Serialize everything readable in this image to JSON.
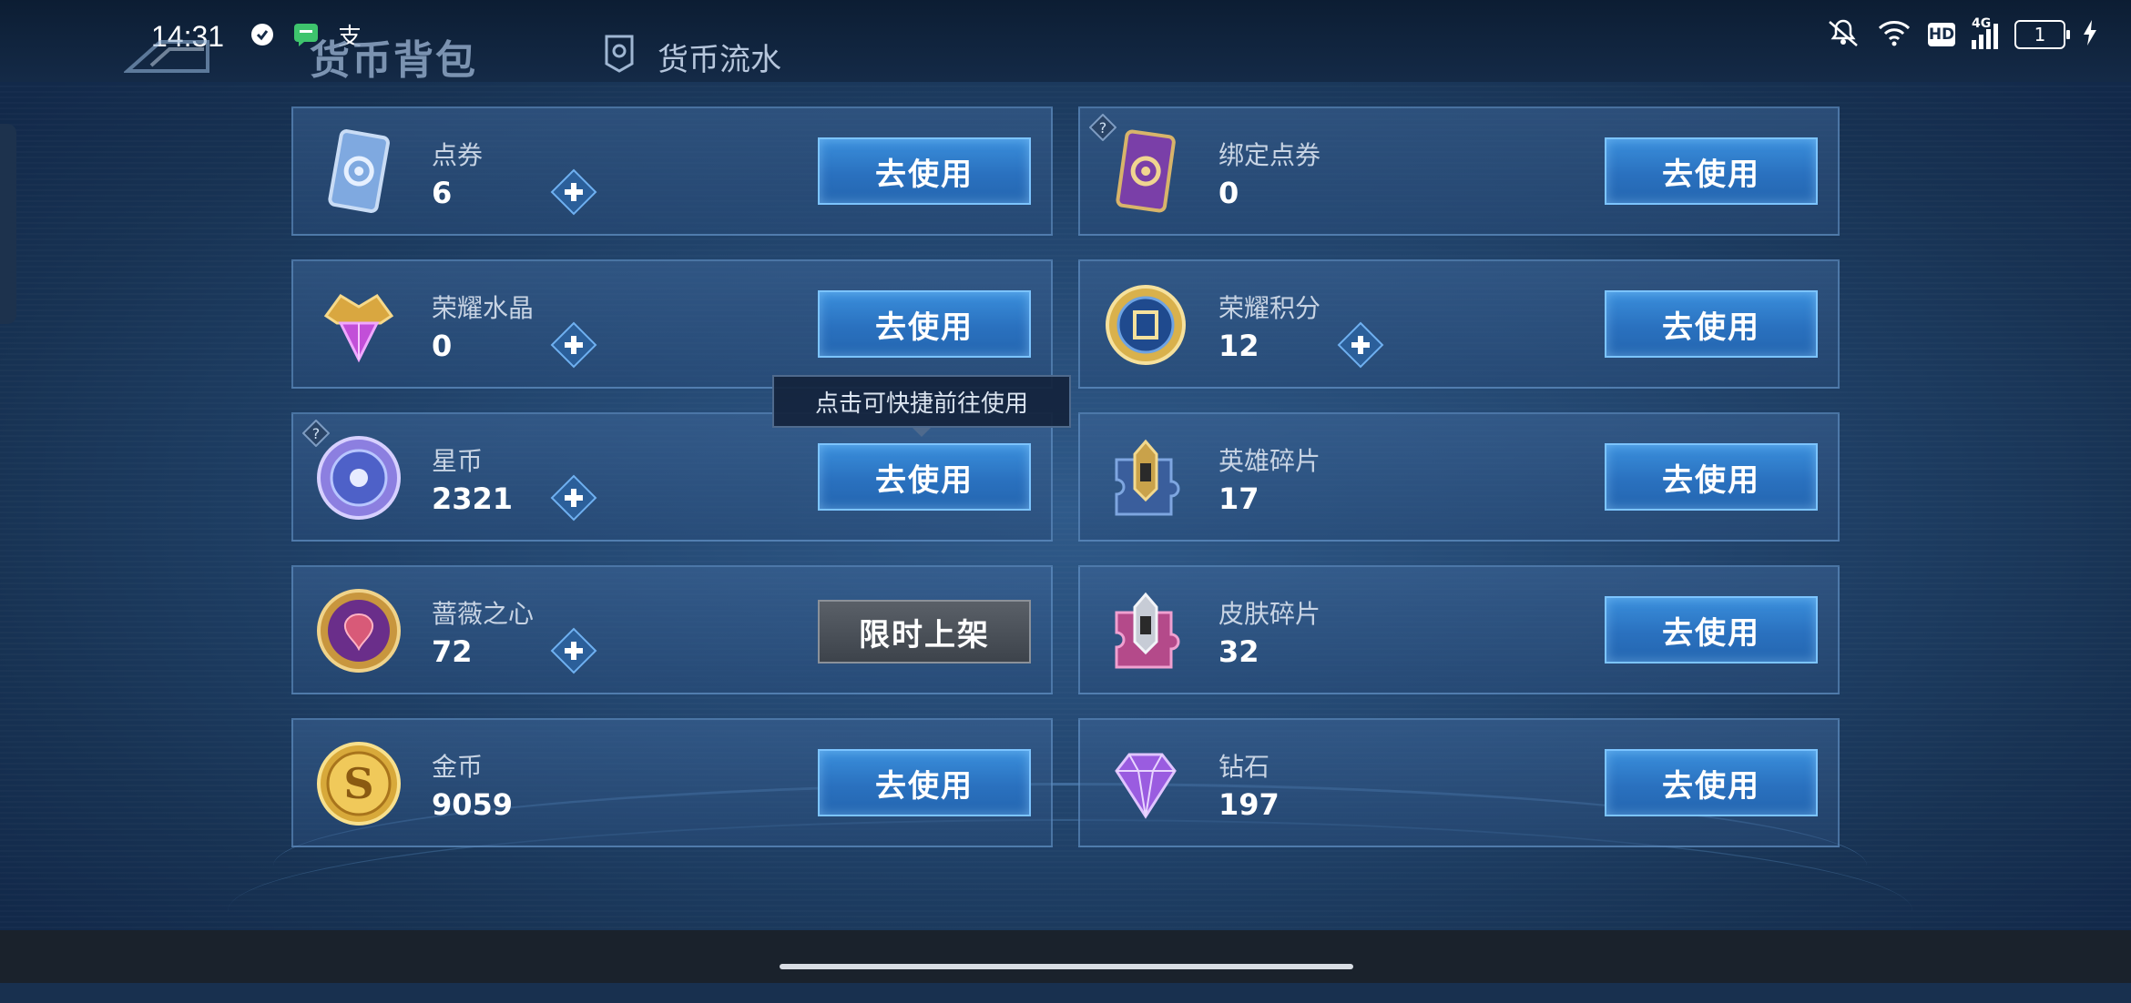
{
  "status_bar": {
    "time": "14:31",
    "left_icons": [
      "shield-icon",
      "message-icon",
      "alipay-icon"
    ],
    "alipay_glyph": "支",
    "right_icons": [
      "mute-icon",
      "wifi-icon",
      "hd-icon",
      "4g-signal-icon",
      "battery-icon",
      "charging-icon"
    ],
    "hd_label": "HD",
    "network_label": "4G",
    "battery_level": "1"
  },
  "header": {
    "title": "货币背包",
    "flow_tab_label": "货币流水"
  },
  "tooltip": {
    "text": "点击可快捷前往使用"
  },
  "currencies": [
    {
      "name": "点券",
      "amount": "6",
      "icon": "coupon-card-icon",
      "has_plus": true,
      "has_help": false,
      "button": "去使用"
    },
    {
      "name": "绑定点券",
      "amount": "0",
      "icon": "bound-coupon-card-icon",
      "has_plus": false,
      "has_help": true,
      "button": "去使用"
    },
    {
      "name": "荣耀水晶",
      "amount": "0",
      "icon": "glory-crystal-icon",
      "has_plus": true,
      "has_help": false,
      "button": "去使用"
    },
    {
      "name": "荣耀积分",
      "amount": "12",
      "icon": "glory-points-icon",
      "has_plus": true,
      "has_help": false,
      "button": "去使用"
    },
    {
      "name": "星币",
      "amount": "2321",
      "icon": "star-coin-icon",
      "has_plus": true,
      "has_help": true,
      "button": "去使用"
    },
    {
      "name": "英雄碎片",
      "amount": "17",
      "icon": "hero-fragment-icon",
      "has_plus": false,
      "has_help": false,
      "button": "去使用"
    },
    {
      "name": "蔷薇之心",
      "amount": "72",
      "icon": "rose-heart-icon",
      "has_plus": true,
      "has_help": false,
      "button": "限时上架"
    },
    {
      "name": "皮肤碎片",
      "amount": "32",
      "icon": "skin-fragment-icon",
      "has_plus": false,
      "has_help": false,
      "button": "去使用"
    },
    {
      "name": "金币",
      "amount": "9059",
      "icon": "gold-coin-icon",
      "has_plus": false,
      "has_help": false,
      "button": "去使用"
    },
    {
      "name": "钻石",
      "amount": "197",
      "icon": "diamond-icon",
      "has_plus": false,
      "has_help": false,
      "button": "去使用"
    }
  ],
  "colors": {
    "use_button": "#2a71bf",
    "limited_button": "#4a5058",
    "card_border": "#78aae1"
  }
}
